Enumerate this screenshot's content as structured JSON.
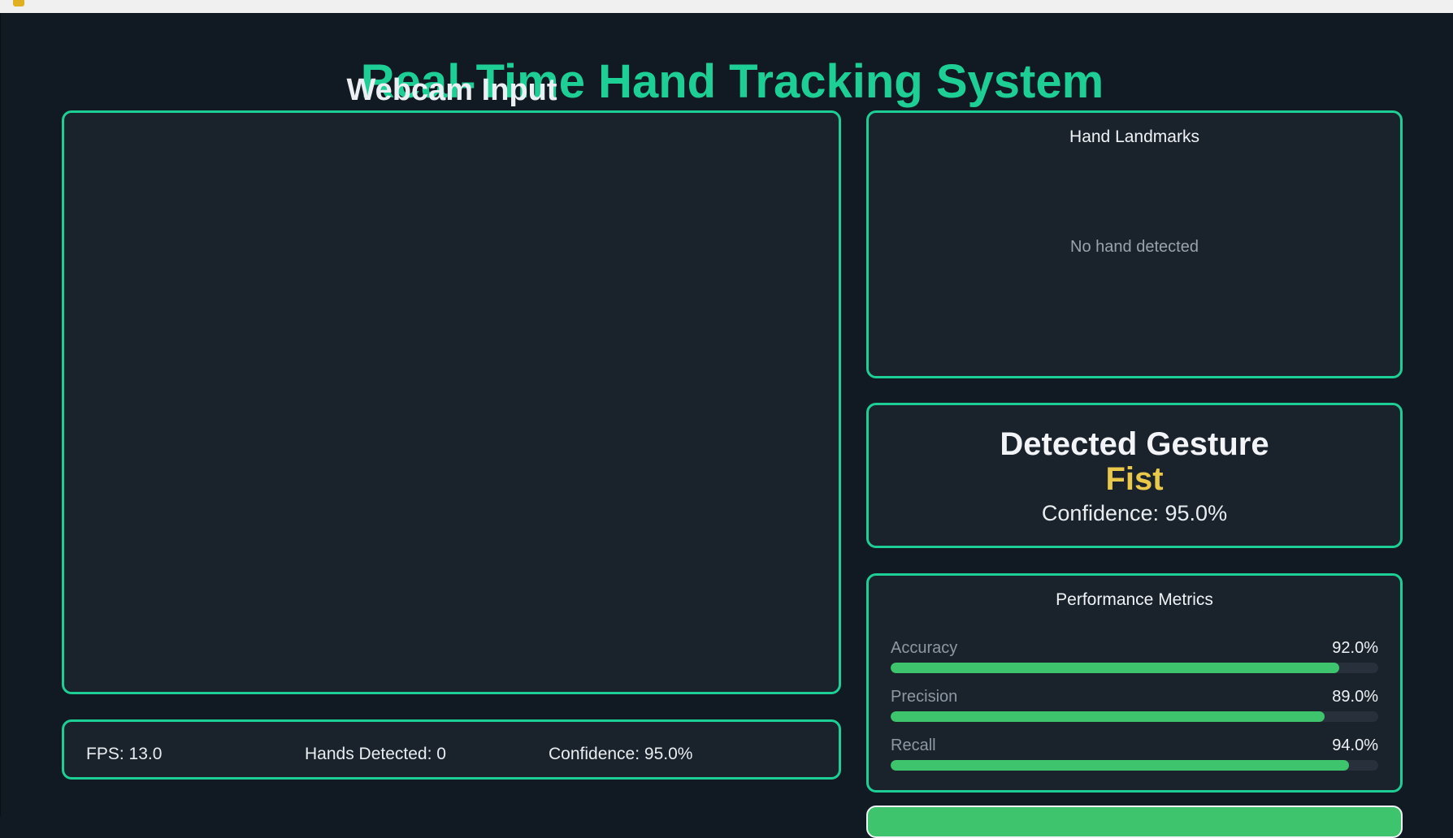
{
  "app": {
    "title": "Real-Time Hand Tracking System"
  },
  "window": {
    "title": ""
  },
  "page": {
    "title": "Real-Time Hand Tracking System"
  },
  "webcam": {
    "title": "Webcam Input"
  },
  "stats": {
    "fps": "FPS: 13.0",
    "hands": "Hands Detected: 0",
    "confidence": "Confidence: 95.0%"
  },
  "landmarks": {
    "title": "Hand Landmarks",
    "empty_text": "No hand detected"
  },
  "gesture": {
    "heading": "Detected Gesture",
    "name": "Fist",
    "confidence": "Confidence: 95.0%"
  },
  "metrics": {
    "title": "Performance Metrics",
    "items": [
      {
        "label": "Accuracy",
        "value_text": "92.0%",
        "value": 0.92
      },
      {
        "label": "Precision",
        "value_text": "89.0%",
        "value": 0.89
      },
      {
        "label": "Recall",
        "value_text": "94.0%",
        "value": 0.94
      }
    ]
  },
  "colors": {
    "background": "#111a22",
    "panel": "#1a222c",
    "accent": "#1ecf95",
    "gesture": "#e9c84a",
    "bar": "#3ec46c"
  },
  "icons": {
    "app": "app-icon"
  }
}
